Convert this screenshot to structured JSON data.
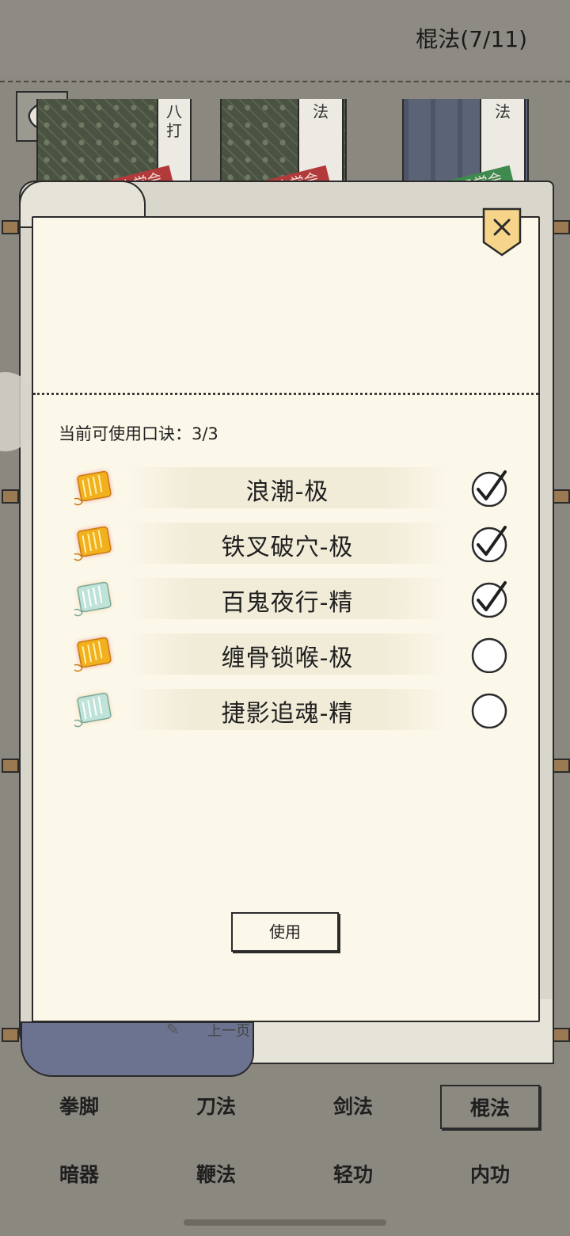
{
  "header": {
    "title": "棍法(7/11)"
  },
  "shelf": {
    "books": [
      {
        "label": "八\n打",
        "stamp": "未学会"
      },
      {
        "label": "法",
        "stamp": "未学会"
      },
      {
        "label": "法",
        "stamp": "已学会"
      }
    ]
  },
  "modal": {
    "usage": "当前可使用口诀：3/3",
    "items": [
      {
        "label": "浪潮-极",
        "grade": "gold",
        "checked": true
      },
      {
        "label": "铁叉破穴-极",
        "grade": "gold",
        "checked": true
      },
      {
        "label": "百鬼夜行-精",
        "grade": "jade",
        "checked": true
      },
      {
        "label": "缠骨锁喉-极",
        "grade": "gold",
        "checked": false
      },
      {
        "label": "捷影追魂-精",
        "grade": "jade",
        "checked": false
      }
    ],
    "use_button": "使用"
  },
  "scroll": {
    "prev_page": "上一页"
  },
  "tabs": {
    "items": [
      {
        "label": "拳脚"
      },
      {
        "label": "刀法"
      },
      {
        "label": "剑法"
      },
      {
        "label": "棍法",
        "active": true
      },
      {
        "label": "暗器"
      },
      {
        "label": "鞭法"
      },
      {
        "label": "轻功"
      },
      {
        "label": "内功"
      }
    ]
  },
  "colors": {
    "gold": "#f2b01e",
    "jade": "#bfe3d9",
    "gold_glow": "#e8433a",
    "jade_glow": "#f0c070"
  }
}
